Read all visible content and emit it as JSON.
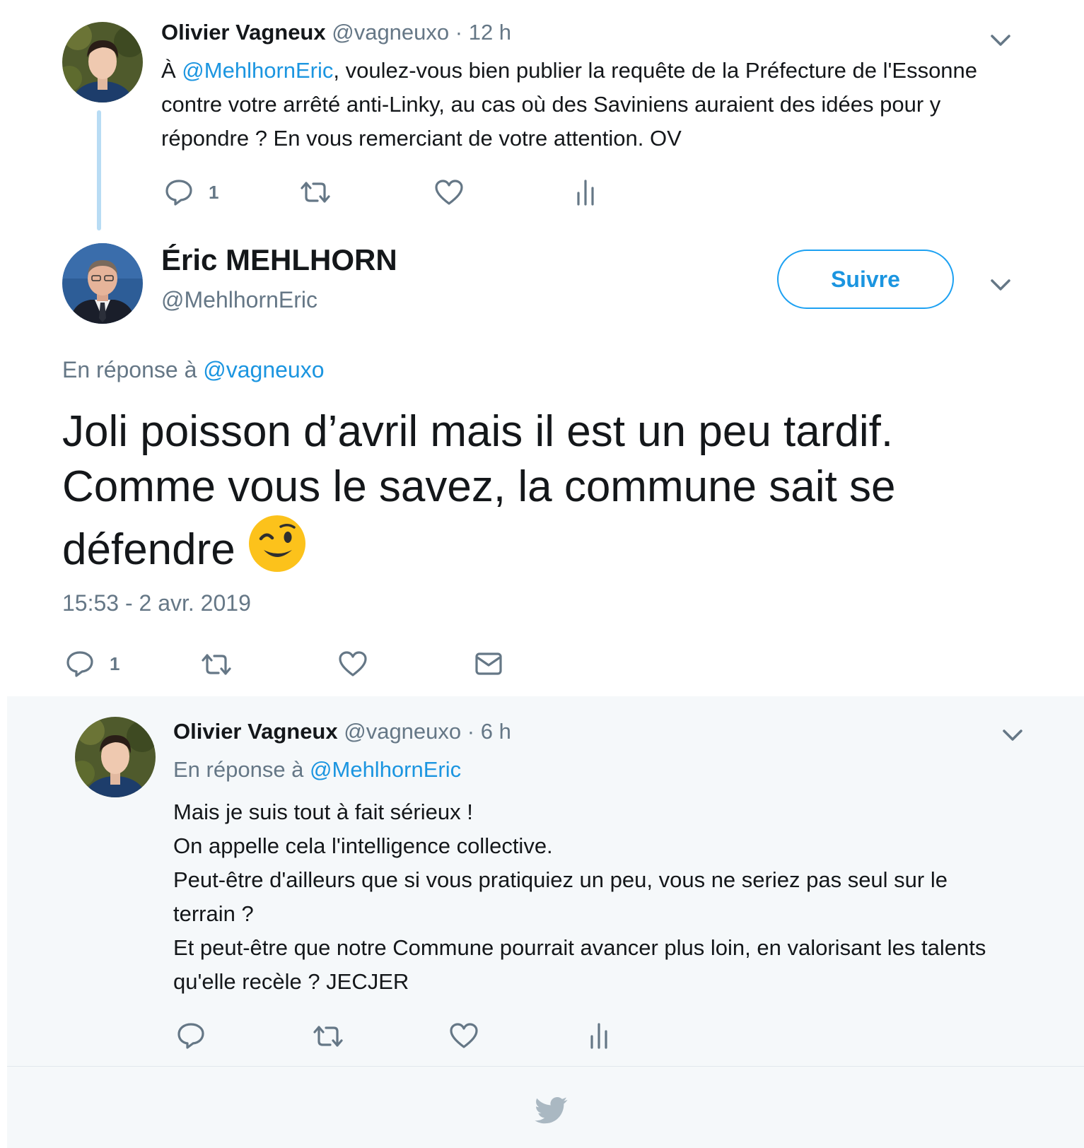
{
  "tweet1": {
    "name": "Olivier Vagneux",
    "handle": "@vagneuxo",
    "time": "· 12 h",
    "prefix": "À ",
    "mention": "@MehlhornEric",
    "text": ", voulez-vous bien publier la requête de la Préfecture de l'Essonne contre votre arrêté anti-Linky, au cas où des Saviniens auraient des idées pour y répondre ? En vous remerciant de votre attention. OV",
    "reply_count": "1"
  },
  "main_tweet": {
    "name": "Éric MEHLHORN",
    "handle": "@MehlhornEric",
    "follow_label": "Suivre",
    "reply_to_prefix": "En réponse à ",
    "reply_to_handle": "@vagneuxo",
    "text": "Joli poisson d’avril mais il est un peu tardif. Comme vous le savez, la commune sait se défendre",
    "timestamp": "15:53 - 2 avr. 2019",
    "reply_count": "1"
  },
  "tweet3": {
    "name": "Olivier Vagneux",
    "handle": "@vagneuxo",
    "time": "· 6 h",
    "reply_to_prefix": "En réponse à ",
    "reply_to_handle": "@MehlhornEric",
    "lines": [
      "Mais je suis tout à fait sérieux !",
      "On appelle cela l'intelligence collective.",
      "Peut-être d'ailleurs que si vous pratiquiez un peu, vous ne seriez pas seul sur le terrain ?",
      "Et peut-être que notre Commune pourrait avancer plus loin, en valorisant les talents qu'elle recèle ? JECJER"
    ]
  },
  "icons": {
    "reply": "reply-icon",
    "retweet": "retweet-icon",
    "like": "heart-icon",
    "analytics": "analytics-icon",
    "dm": "envelope-icon",
    "more": "chevron-down-icon",
    "emoji": "winking-face-emoji",
    "logo": "twitter-bird-icon"
  },
  "colors": {
    "accent": "#1da1f2",
    "link": "#1b95e0",
    "muted": "#657786",
    "text": "#14171a",
    "thread_line": "#b8dcf4",
    "reply_bg": "#f5f8fa"
  }
}
